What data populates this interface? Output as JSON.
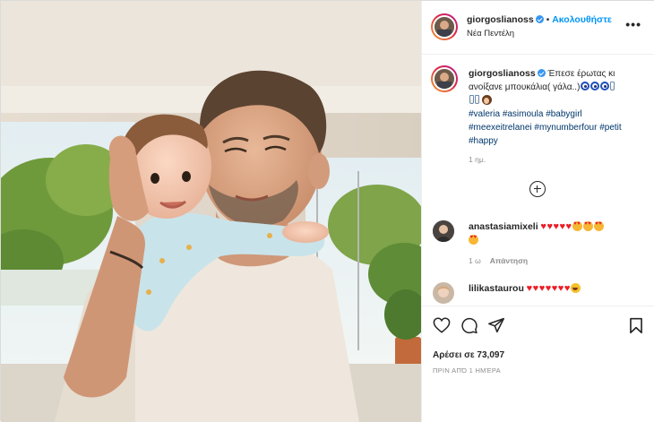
{
  "post": {
    "username": "giorgoslianoss",
    "follow_label": "Ακολουθήστε",
    "dot": "•",
    "location": "Νέα Πεντέλη",
    "more_label": "•••",
    "photo_icon": "baby-and-father-photo"
  },
  "caption": {
    "username": "giorgoslianoss",
    "text": "Έπεσε έρωτας κι ανοίξανε μπουκάλια( γάλα..)",
    "hashtags": [
      "#valeria",
      "#asimoula",
      "#babygirl",
      "#meexeitrelanei",
      "#mynumberfour",
      "#petit",
      "#happy"
    ],
    "time": "1 ημ."
  },
  "comments": [
    {
      "username": "anastasiamixeli",
      "time": "1 ω",
      "reply_label": "Απάντηση"
    },
    {
      "username": "lilikastaurou"
    }
  ],
  "actions": {
    "likes": "Αρέσει σε 73,097",
    "posted": "ΠΡΙΝ ΑΠΌ 1 ΗΜΈΡΑ"
  },
  "colors": {
    "link": "#0095f6",
    "hashtag": "#00376b",
    "muted": "#8e8e8e",
    "heart": "#ed1c24"
  }
}
